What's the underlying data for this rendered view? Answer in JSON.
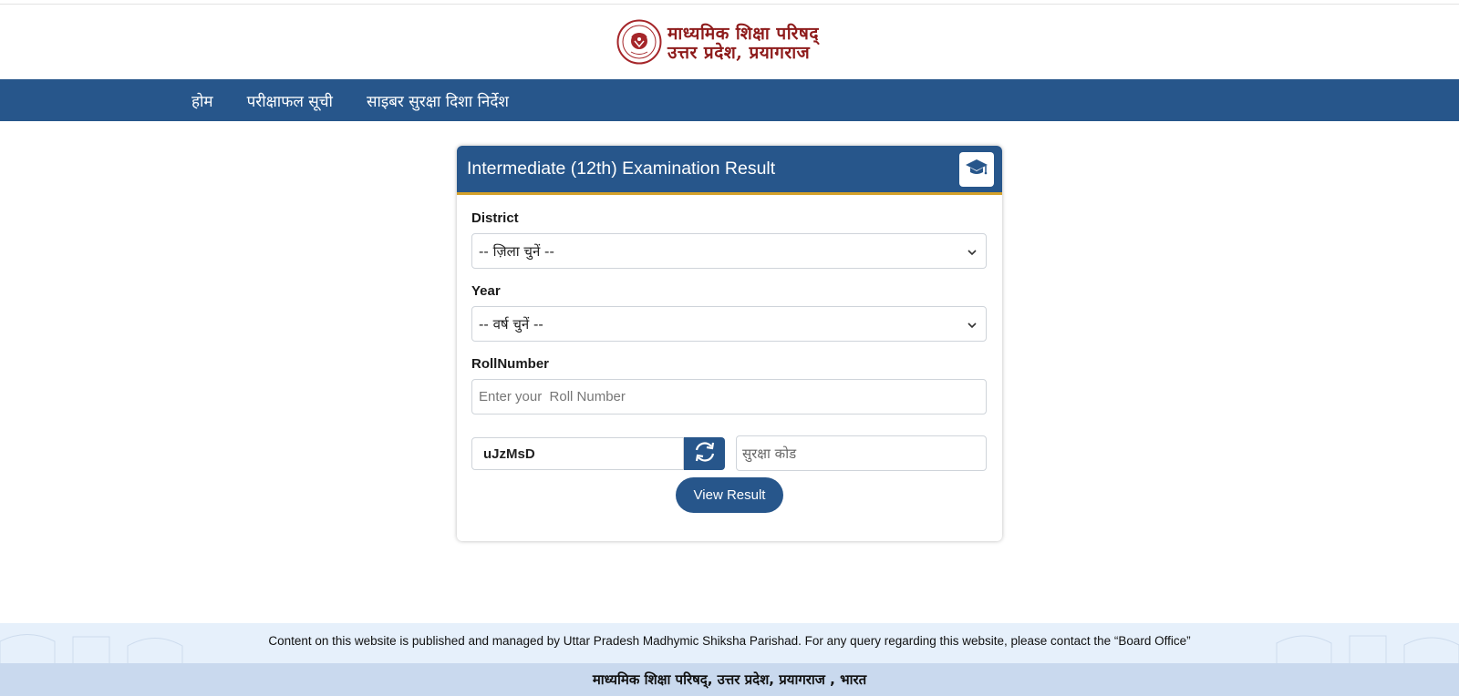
{
  "header": {
    "org_name_line1": "माध्यमिक शिक्षा परिषद्",
    "org_name_line2": "उत्तर प्रदेश, प्रयागराज",
    "logo_icon": "up-govt-seal-icon"
  },
  "nav": {
    "items": [
      {
        "label": "होम"
      },
      {
        "label": "परीक्षाफल सूची"
      },
      {
        "label": "साइबर सुरक्षा दिशा निर्देश"
      }
    ]
  },
  "form": {
    "title": "Intermediate (12th) Examination Result",
    "title_icon": "graduation-cap-icon",
    "district_label": "District",
    "district_selected": "-- ज़िला चुनें --",
    "year_label": "Year",
    "year_selected": "-- वर्ष चुनें --",
    "roll_label": "RollNumber",
    "roll_placeholder": "Enter your  Roll Number",
    "roll_value": "",
    "captcha_text": "uJzMsD",
    "refresh_icon": "refresh-icon",
    "code_placeholder": "सुरक्षा कोड",
    "code_value": "",
    "submit_label": "View Result"
  },
  "footer": {
    "info_text": "Content on this website is published and managed by Uttar Pradesh Madhymic Shiksha Parishad. For any query regarding this website, please contact the “Board Office”",
    "bottom_text": "माध्यमिक शिक्षा परिषद्, उत्तर प्रदेश, प्रयागराज , भारत"
  },
  "colors": {
    "primary": "#27568b",
    "accent": "#d4a12a",
    "brand_red": "#8e1b1b",
    "footer_light": "#e6f0fb",
    "footer_dark": "#c9d9ee"
  }
}
